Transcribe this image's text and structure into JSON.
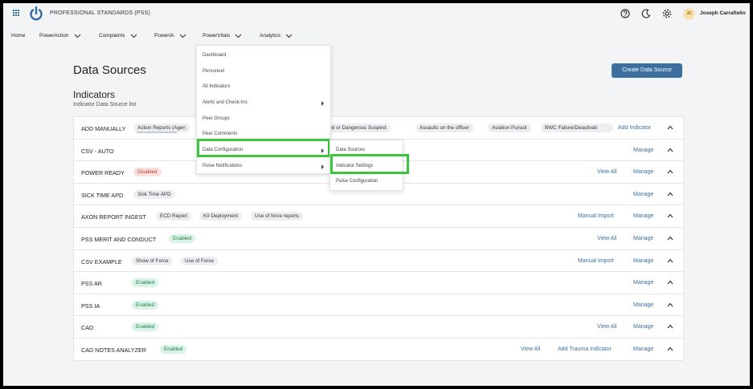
{
  "app": {
    "brand": "PROFESSIONAL STANDARDS (PSS)",
    "user_initials": "JC",
    "user_name": "Joseph Carrafiello"
  },
  "icons": {
    "apps": "grid-icon",
    "logo": "power-icon",
    "help": "help-icon",
    "theme": "moon-icon",
    "settings": "gear-icon"
  },
  "nav": [
    "Home",
    "PowerAction",
    "Complaints",
    "PowerIA",
    "PowerVitals",
    "Analytics"
  ],
  "page": {
    "title": "Data Sources",
    "create_button": "Create Data Source",
    "section_title": "Indicators",
    "section_subtitle": "Indicator Data Source list"
  },
  "rows": [
    {
      "name": "ADD MANUALLY",
      "chips": [
        "Action Reports (Agen",
        "rmed or Dangerous Suspect",
        "Assaults on the officer",
        "Aviation Pursuit",
        "BWC Failure/Deactivati"
      ],
      "links": [
        "Add Indicator"
      ]
    },
    {
      "name": "CSV - AUTO",
      "chips": [],
      "links": [
        "Manage"
      ]
    },
    {
      "name": "POWER READY",
      "chips": [
        "Disabled"
      ],
      "links": [
        "View All",
        "Manage"
      ]
    },
    {
      "name": "SICK TIME APD",
      "chips": [
        "Sick Time APD"
      ],
      "links": [
        "Manage"
      ]
    },
    {
      "name": "AXON REPORT INGEST",
      "chips": [
        "ECD Report",
        "K9 Deployment",
        "Use of force reports"
      ],
      "links": [
        "Manual Import",
        "Manage"
      ]
    },
    {
      "name": "PSS MERIT AND CONDUCT",
      "chips": [
        "Enabled"
      ],
      "links": [
        "View All",
        "Manage"
      ]
    },
    {
      "name": "CSV EXAMPLE",
      "chips": [
        "Show of Force",
        "Use of Force"
      ],
      "links": [
        "Manual Import",
        "Manage"
      ]
    },
    {
      "name": "PSS AR",
      "chips": [
        "Enabled"
      ],
      "links": [
        "Manage"
      ]
    },
    {
      "name": "PSS IA",
      "chips": [
        "Enabled"
      ],
      "links": [
        "Manage"
      ]
    },
    {
      "name": "CAD",
      "chips": [
        "Enabled"
      ],
      "links": [
        "View All",
        "Manage"
      ]
    },
    {
      "name": "CAD NOTES ANALYZER",
      "chips": [
        "Enabled"
      ],
      "links": [
        "View All",
        "Add Trauma Indicator",
        "Manage"
      ]
    }
  ],
  "menu": [
    "Dashboard",
    "Personnel",
    "All Indicators",
    "Alerts and Check-Ins",
    "Peer Groups",
    "Peer Comments",
    "Data Configuration",
    "Pulse Notifications"
  ],
  "submenu": [
    "Data Sources",
    "Indicator Settings",
    "Pulse Configuration"
  ],
  "colors": {
    "accent": "#3b6fa0",
    "highlight": "#3cc43c",
    "enabled": "#d9f4e6",
    "disabled": "#fbe0df"
  }
}
